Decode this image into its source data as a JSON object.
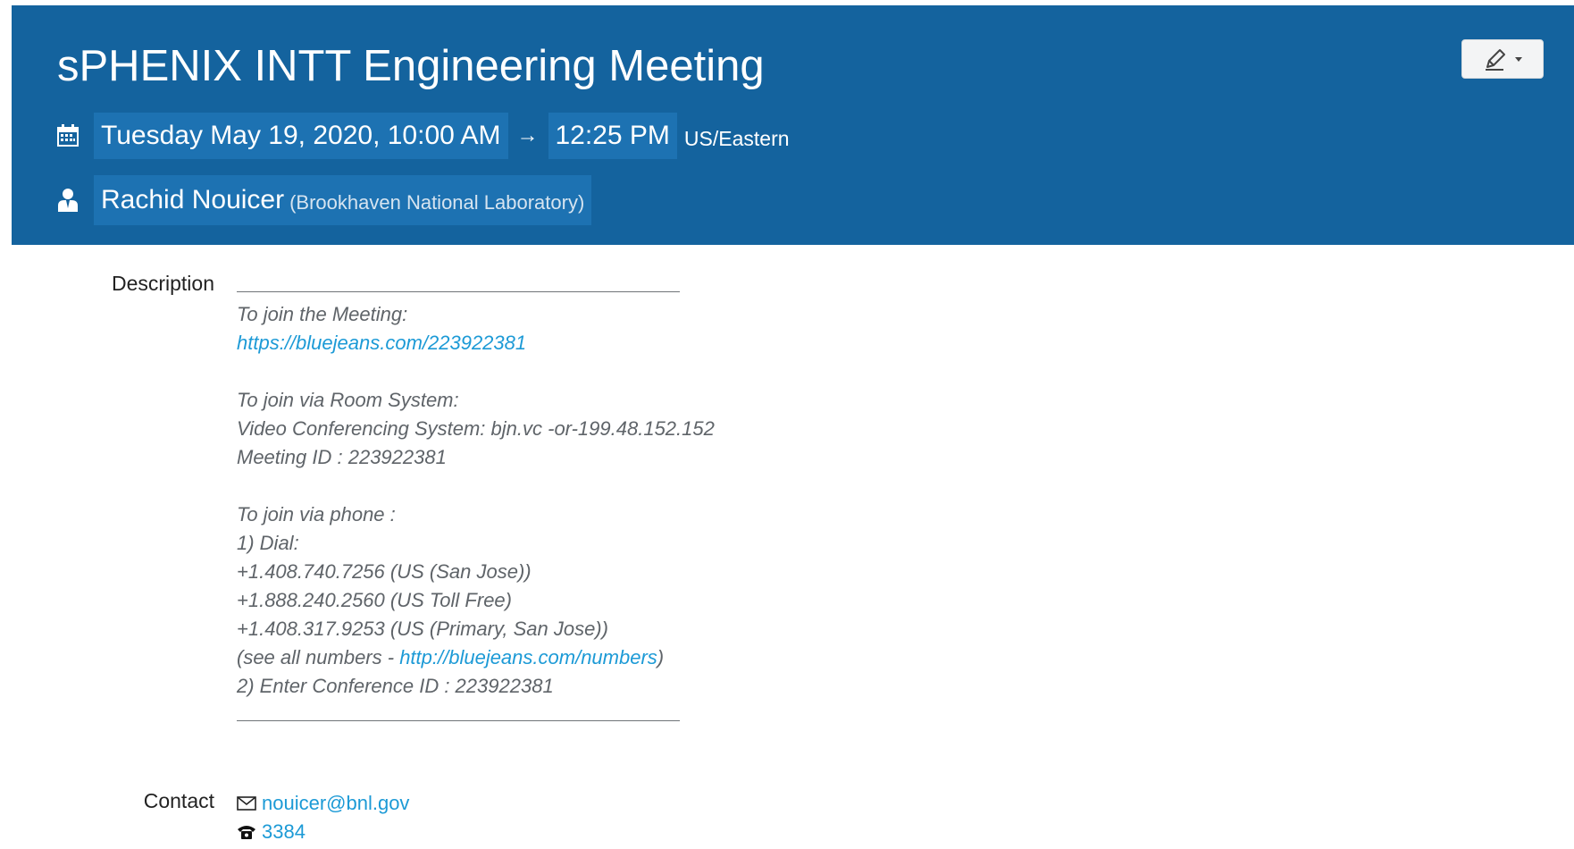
{
  "event": {
    "title": "sPHENIX INTT Engineering Meeting",
    "date_start": "Tuesday May 19, 2020, 10:00 AM",
    "arrow": "→",
    "time_end": "12:25 PM",
    "timezone": "US/Eastern",
    "chair_name": "Rachid Nouicer",
    "chair_affiliation": "(Brookhaven National Laboratory)"
  },
  "toolbar": {
    "edit_icon": "pencil-icon",
    "dropdown_icon": "caret-down-icon"
  },
  "icons": {
    "calendar": "calendar-icon",
    "person": "user-icon",
    "mail": "envelope-icon",
    "phone": "phone-icon"
  },
  "description": {
    "label": "Description",
    "line_01": "To join the Meeting:",
    "link_meeting": "https://bluejeans.com/223922381",
    "line_03": "To join via Room System:",
    "line_04": "Video Conferencing System: bjn.vc -or-199.48.152.152",
    "line_05": "Meeting ID : 223922381",
    "line_06": "To join via phone :",
    "line_07": "1) Dial:",
    "line_08": "+1.408.740.7256 (US (San Jose))",
    "line_09": "+1.888.240.2560 (US Toll Free)",
    "line_10": "+1.408.317.9253 (US (Primary, San Jose))",
    "see_all_prefix": "(see all numbers - ",
    "link_numbers": "http://bluejeans.com/numbers",
    "see_all_suffix": ")",
    "line_12": "2) Enter Conference ID : 223922381"
  },
  "contact": {
    "label": "Contact",
    "email": "nouicer@bnl.gov",
    "phone": "3384"
  },
  "colors": {
    "header_bg": "#14639e",
    "chip_bg": "#1d72b2",
    "link": "#1c9ad6"
  }
}
